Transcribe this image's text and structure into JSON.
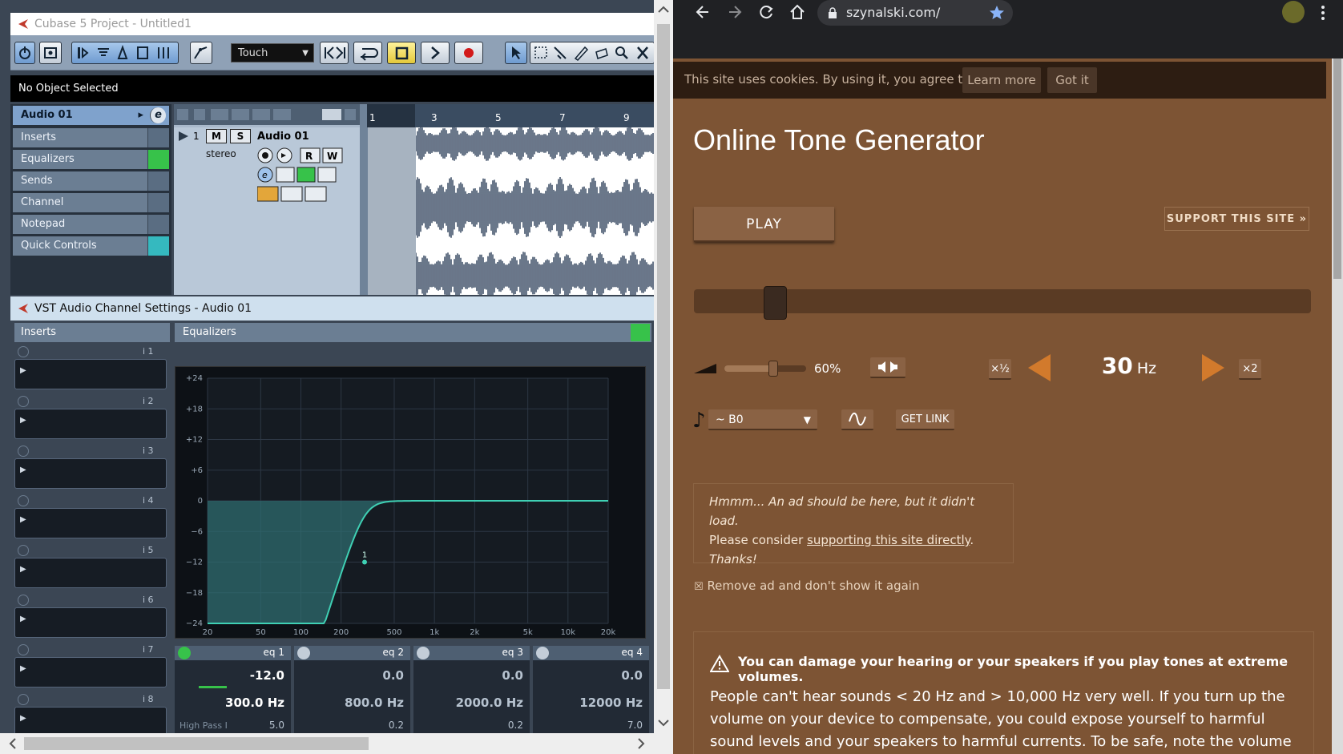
{
  "cubase": {
    "window_title": "Cubase 5 Project - Untitled1",
    "automation_mode": "Touch",
    "info_line": "No Object Selected",
    "inspector": {
      "track_name": "Audio 01",
      "sections": [
        "Inserts",
        "Equalizers",
        "Sends",
        "Channel",
        "Notepad",
        "Quick Controls"
      ]
    },
    "track": {
      "number": "1",
      "name": "Audio 01",
      "mode": "stereo",
      "mute_label": "M",
      "solo_label": "S",
      "read_label": "R",
      "write_label": "W"
    },
    "ruler": [
      "1",
      "3",
      "5",
      "7",
      "9"
    ],
    "vst_window": {
      "title": "VST Audio Channel Settings - Audio 01",
      "inserts_label": "Inserts",
      "equalizers_label": "Equalizers",
      "insert_slots": [
        "i 1",
        "i 2",
        "i 3",
        "i 4",
        "i 5",
        "i 6",
        "i 7",
        "i 8"
      ],
      "eq_graph": {
        "y_ticks": [
          "+24",
          "+18",
          "+12",
          "+6",
          "0",
          "−6",
          "−12",
          "−18",
          "−24"
        ],
        "x_ticks": [
          "20",
          "50",
          "100",
          "200",
          "500",
          "1k",
          "2k",
          "5k",
          "10k",
          "20k"
        ],
        "point_label": "1"
      },
      "eq_bands": [
        {
          "name": "eq 1",
          "gain": "-12.0",
          "freq": "300.0 Hz",
          "type": "High Pass I",
          "q": "5.0"
        },
        {
          "name": "eq 2",
          "gain": "0.0",
          "freq": "800.0 Hz",
          "q": "0.2"
        },
        {
          "name": "eq 3",
          "gain": "0.0",
          "freq": "2000.0 Hz",
          "q": "0.2"
        },
        {
          "name": "eq 4",
          "gain": "0.0",
          "freq": "12000 Hz",
          "q": "7.0"
        }
      ]
    }
  },
  "browser": {
    "url": "szynalski.com/",
    "cookie_text": "This site uses cookies. By using it, you agree to this.",
    "learn_more": "Learn more",
    "got_it": "Got it",
    "title": "Online Tone Generator",
    "play_label": "PLAY",
    "support_label": "SUPPORT THIS SITE »",
    "volume_label": "60%",
    "volume_fraction": 0.6,
    "half_label": "×½",
    "double_label": "×2",
    "freq_value": "30",
    "freq_unit": "Hz",
    "note_value": "~ B0",
    "get_link": "GET LINK",
    "ad_text_1": "Hmmm... An ad should be here, but it didn't load.",
    "ad_text_2": "Please consider ",
    "ad_link": "supporting this site directly",
    "ad_text_3": ".",
    "ad_text_4": "Thanks!",
    "remove_ad": "Remove ad and don't show it again",
    "warning_title": "You can damage your hearing or your speakers if you play tones at extreme volumes.",
    "warning_body": "People can't hear sounds < 20 Hz and > 10,000 Hz very well. If you turn up the volume on your device to compensate, you could expose yourself to harmful sound levels and your speakers to harmful currents. To be safe, note the volume level that allows you to"
  },
  "colors": {
    "cubase_bg": "#3b4654",
    "site_bg": "#7d5434",
    "accent_orange": "#d27a2c"
  }
}
